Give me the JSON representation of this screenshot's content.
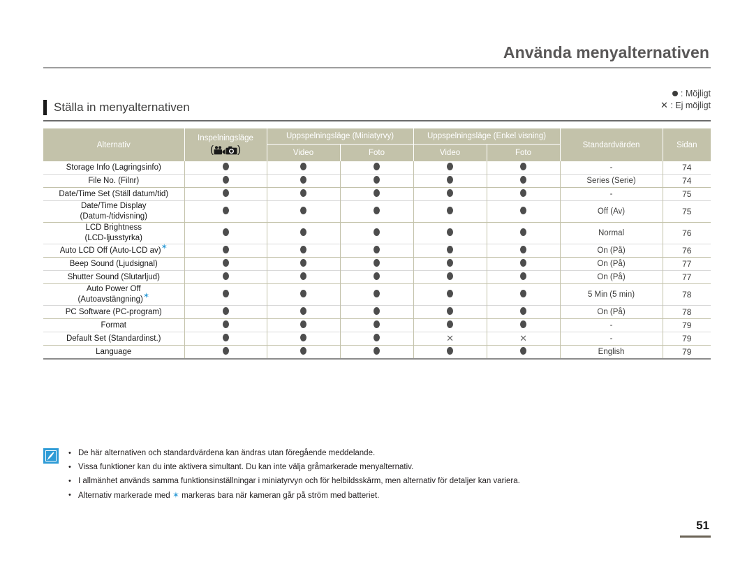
{
  "document": {
    "title": "Använda menyalternativen",
    "section_title": "Ställa in menyalternativen",
    "page_number": "51"
  },
  "legend": {
    "available_symbol": "dot-symbol",
    "available_label": ": Möjligt",
    "unavailable_symbol": "✕",
    "unavailable_label": ": Ej möjligt"
  },
  "table": {
    "headers": {
      "option": "Alternativ",
      "recording_mode": "Inspelningsläge",
      "recording_mode_icons": "video-camera-icon photo-camera-icon",
      "playback_thumbnail": "Uppspelningsläge (Miniatyrvy)",
      "playback_single": "Uppspelningsläge (Enkel visning)",
      "video": "Video",
      "photo": "Foto",
      "defaults": "Standardvärden",
      "page": "Sidan"
    },
    "rows": [
      {
        "option": "Storage Info (Lagringsinfo)",
        "star": false,
        "rec": "dot",
        "thumb_video": "dot",
        "thumb_photo": "dot",
        "single_video": "dot",
        "single_photo": "dot",
        "default": "-",
        "page": "74"
      },
      {
        "option": "File No. (Filnr)",
        "star": false,
        "rec": "dot",
        "thumb_video": "dot",
        "thumb_photo": "dot",
        "single_video": "dot",
        "single_photo": "dot",
        "default": "Series (Serie)",
        "page": "74"
      },
      {
        "option": "Date/Time Set (Ställ datum/tid)",
        "star": false,
        "rec": "dot",
        "thumb_video": "dot",
        "thumb_photo": "dot",
        "single_video": "dot",
        "single_photo": "dot",
        "default": "-",
        "page": "75"
      },
      {
        "option": "Date/Time Display\n(Datum-/tidvisning)",
        "star": false,
        "rec": "dot",
        "thumb_video": "dot",
        "thumb_photo": "dot",
        "single_video": "dot",
        "single_photo": "dot",
        "default": "Off (Av)",
        "page": "75"
      },
      {
        "option": "LCD Brightness\n(LCD-ljusstyrka)",
        "star": false,
        "rec": "dot",
        "thumb_video": "dot",
        "thumb_photo": "dot",
        "single_video": "dot",
        "single_photo": "dot",
        "default": "Normal",
        "page": "76"
      },
      {
        "option": "Auto LCD Off (Auto-LCD av)",
        "star": true,
        "rec": "dot",
        "thumb_video": "dot",
        "thumb_photo": "dot",
        "single_video": "dot",
        "single_photo": "dot",
        "default": "On (På)",
        "page": "76"
      },
      {
        "option": "Beep Sound (Ljudsignal)",
        "star": false,
        "rec": "dot",
        "thumb_video": "dot",
        "thumb_photo": "dot",
        "single_video": "dot",
        "single_photo": "dot",
        "default": "On (På)",
        "page": "77"
      },
      {
        "option": "Shutter Sound (Slutarljud)",
        "star": false,
        "rec": "dot",
        "thumb_video": "dot",
        "thumb_photo": "dot",
        "single_video": "dot",
        "single_photo": "dot",
        "default": "On (På)",
        "page": "77"
      },
      {
        "option": "Auto Power Off\n(Autoavstängning)",
        "star": true,
        "rec": "dot",
        "thumb_video": "dot",
        "thumb_photo": "dot",
        "single_video": "dot",
        "single_photo": "dot",
        "default": "5 Min (5 min)",
        "page": "78"
      },
      {
        "option": "PC Software (PC-program)",
        "star": false,
        "rec": "dot",
        "thumb_video": "dot",
        "thumb_photo": "dot",
        "single_video": "dot",
        "single_photo": "dot",
        "default": "On (På)",
        "page": "78"
      },
      {
        "option": "Format",
        "star": false,
        "rec": "dot",
        "thumb_video": "dot",
        "thumb_photo": "dot",
        "single_video": "dot",
        "single_photo": "dot",
        "default": "-",
        "page": "79"
      },
      {
        "option": "Default Set (Standardinst.)",
        "star": false,
        "rec": "dot",
        "thumb_video": "dot",
        "thumb_photo": "dot",
        "single_video": "x",
        "single_photo": "x",
        "default": "-",
        "page": "79"
      },
      {
        "option": "Language",
        "star": false,
        "rec": "dot",
        "thumb_video": "dot",
        "thumb_photo": "dot",
        "single_video": "dot",
        "single_photo": "dot",
        "default": "English",
        "page": "79"
      }
    ]
  },
  "notes": {
    "icon": "note-pen-icon",
    "items": [
      "De här alternativen och standardvärdena kan ändras utan föregående meddelande.",
      "Vissa funktioner kan du inte aktivera simultant. Du kan inte välja gråmarkerade menyalternativ.",
      "I allmänhet används samma funktionsinställningar i miniatyrvyn och för helbildsskärm, men alternativ för detaljer kan variera.",
      "Alternativ markerade med ★ markeras bara när kameran går på ström med batteriet."
    ],
    "note4_prefix": "Alternativ markerade med ",
    "note4_star": "✶",
    "note4_suffix": " markeras bara när kameran går på ström med batteriet."
  },
  "colors": {
    "header_bg": "#c3c2aa",
    "accent_blue": "#2e9bd6",
    "rule_gray": "#9e9e9e",
    "text_dark": "#231f20"
  }
}
